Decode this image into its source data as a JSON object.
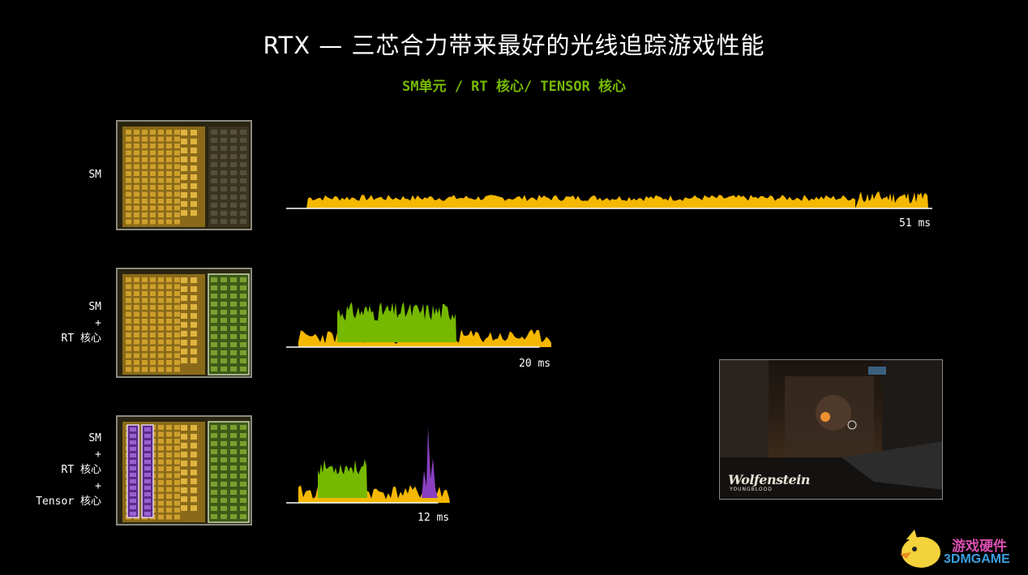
{
  "title": "RTX — 三芯合力带来最好的光线追踪游戏性能",
  "subtitle": "SM单元 / RT 核心/ TENSOR 核心",
  "rows": [
    {
      "label_lines": [
        "SM"
      ],
      "time_label": "51 ms"
    },
    {
      "label_lines": [
        "SM",
        "+",
        "RT 核心"
      ],
      "time_label": "20 ms"
    },
    {
      "label_lines": [
        "SM",
        "+",
        "RT 核心",
        "+",
        "Tensor 核心"
      ],
      "time_label": "12 ms"
    }
  ],
  "chart_data": {
    "type": "area",
    "title": "RTX — 三芯合力带来最好的光线追踪游戏性能",
    "subtitle": "SM单元 / RT 核心/ TENSOR 核心",
    "xlabel": "",
    "ylabel": "",
    "series": [
      {
        "row": "SM",
        "frame_time_ms": 51,
        "colors": {
          "sm": "#f5b800"
        }
      },
      {
        "row": "SM + RT 核心",
        "frame_time_ms": 20,
        "colors": {
          "sm": "#f5b800",
          "rt": "#76b900"
        }
      },
      {
        "row": "SM + RT 核心 + Tensor 核心",
        "frame_time_ms": 12,
        "colors": {
          "sm": "#f5b800",
          "rt": "#76b900",
          "tensor": "#8a3fc0"
        }
      }
    ]
  },
  "game": {
    "logo": "Wolfenstein",
    "logo_sub": "YOUNGBLOOD"
  },
  "watermark": {
    "line1": "游戏硬件",
    "line2": "3DMGAME"
  },
  "colors": {
    "sm": "#f5b800",
    "rt": "#76b900",
    "tensor": "#8a3fc0",
    "accent": "#76b900",
    "background": "#000000"
  }
}
